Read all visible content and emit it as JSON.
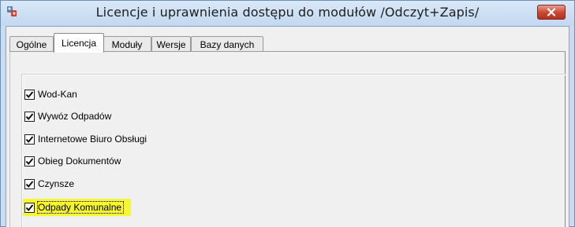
{
  "window": {
    "title": "Licencje i uprawnienia dostępu do modułów /Odczyt+Zapis/"
  },
  "tabs": [
    {
      "label": "Ogólne",
      "active": false
    },
    {
      "label": "Licencja",
      "active": true
    },
    {
      "label": "Moduły",
      "active": false
    },
    {
      "label": "Wersje",
      "active": false
    },
    {
      "label": "Bazy danych",
      "active": false
    }
  ],
  "modules": [
    {
      "label": "Wod-Kan",
      "checked": true
    },
    {
      "label": "Wywóz Odpadów",
      "checked": true
    },
    {
      "label": "Internetowe Biuro Obsługi",
      "checked": true
    },
    {
      "label": "Obieg Dokumentów",
      "checked": true
    },
    {
      "label": "Czynsze",
      "checked": true
    },
    {
      "label": "Odpady Komunalne",
      "checked": true,
      "focused": true,
      "highlight_color": "#f7f72c"
    }
  ],
  "colors": {
    "close_button": "#c9452f",
    "titlebar": "#c2d8f0"
  },
  "icons": {
    "app": "app-icon",
    "close": "close-icon",
    "check": "check-icon"
  }
}
